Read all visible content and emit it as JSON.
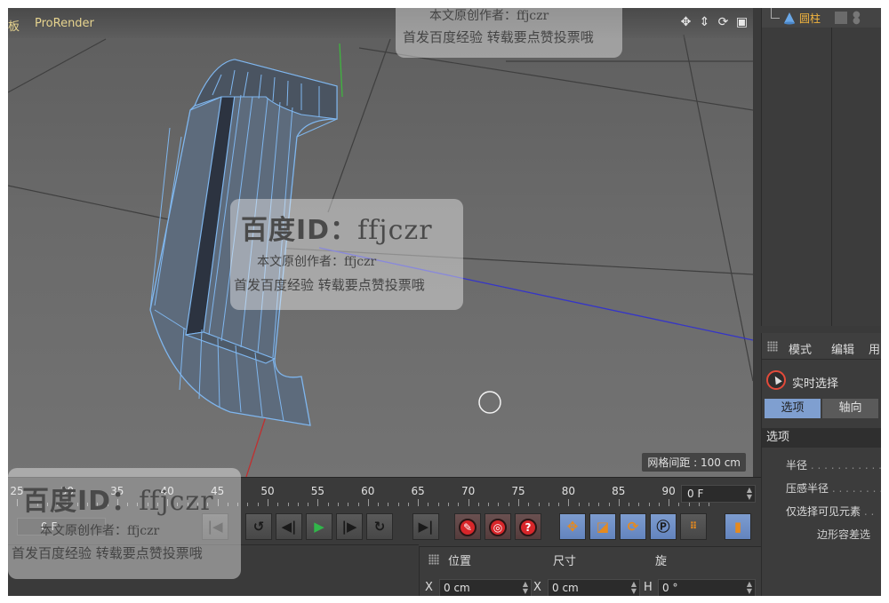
{
  "viewport": {
    "menu_left": "板",
    "menu_prorender": "ProRender",
    "nav_icons": [
      "move-icon",
      "zoom-icon",
      "rotate-icon",
      "maximize-icon"
    ],
    "grid_spacing": "网格间距 : 100 cm"
  },
  "object_manager": {
    "object_name": "圆柱",
    "object_icon": "cylinder-icon"
  },
  "attributes": {
    "menu": [
      "模式",
      "编辑",
      "用"
    ],
    "tool_name": "实时选择",
    "tabs": [
      "选项",
      "轴向"
    ],
    "section": "选项",
    "props": [
      {
        "label": "半径",
        "dots": " . . . . . . . . . . . ."
      },
      {
        "label": "压感半径",
        "dots": " . . . . . . . ."
      },
      {
        "label": "仅选择可见元素",
        "dots": " . ."
      },
      {
        "label": "边形容差选",
        "dots": ""
      }
    ]
  },
  "timeline": {
    "ticks": [
      "25",
      "30",
      "35",
      "40",
      "45",
      "50",
      "55",
      "60",
      "65",
      "70",
      "75",
      "80",
      "85",
      "90"
    ],
    "current_frame": "0 F",
    "left_frame": "0 F"
  },
  "transport": {
    "buttons": [
      {
        "name": "go-start-button",
        "glyph": "|◀"
      },
      {
        "name": "prev-key-button",
        "glyph": "◀|"
      },
      {
        "name": "prev-frame-button",
        "glyph": "◀"
      },
      {
        "name": "play-button",
        "glyph": "▶"
      },
      {
        "name": "next-frame-button",
        "glyph": "|▶"
      },
      {
        "name": "loop-button",
        "glyph": "↻"
      },
      {
        "name": "go-end-button",
        "glyph": "▶|"
      }
    ]
  },
  "coordinates": {
    "headers": [
      "位置",
      "尺寸",
      "旋"
    ],
    "x_label": "X",
    "x_pos": "0 cm",
    "x_size_label": "X",
    "x_size": "0 cm",
    "h_label": "H",
    "h_value": "0 °"
  },
  "watermark": {
    "id_prefix": "百度ID：",
    "id_name": "ffjczr",
    "author": "本文原创作者：ffjczr",
    "notice": "首发百度经验  转载要点赞投票哦"
  },
  "colors": {
    "accent_orange": "#f2b43d",
    "selection_blue": "#7f9fd0",
    "record_red": "#d8262a",
    "play_green": "#31b64a"
  }
}
